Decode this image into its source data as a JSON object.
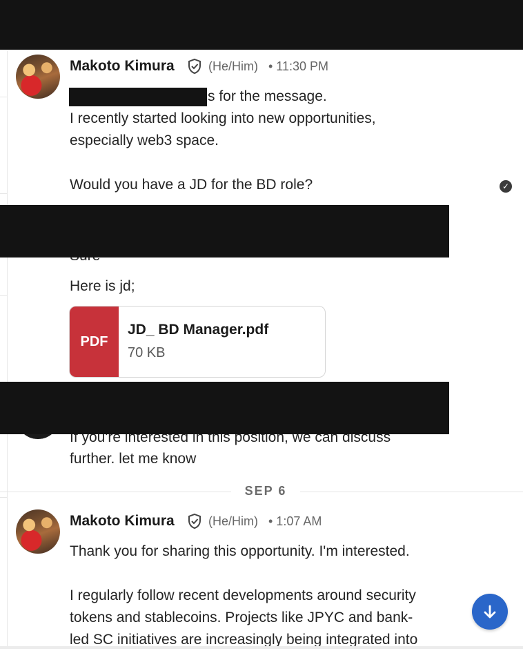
{
  "messages": [
    {
      "sender": "Makoto Kimura",
      "pronouns": "(He/Him)",
      "time": "• 11:30 PM",
      "lines": [
        "s for the message.",
        "I recently started looking into new opportunities,",
        "especially web3 space.",
        "",
        "Would you have a JD for the BD role?"
      ]
    },
    {
      "lines": [
        "Sure",
        "Here is jd;"
      ],
      "attachment": {
        "type_label": "PDF",
        "file_name": "JD_ BD Manager.pdf",
        "file_size": "70 KB"
      }
    },
    {
      "lines": [
        "If you're interested in this position, we can discuss",
        "further. let me know"
      ]
    },
    {
      "sender": "Makoto Kimura",
      "pronouns": "(He/Him)",
      "time": "• 1:07 AM",
      "lines": [
        "Thank you for sharing this opportunity. I'm interested.",
        "",
        "I regularly follow recent developments around security",
        "tokens and stablecoins. Projects like JPYC and bank-",
        "led SC initiatives are increasingly being integrated into"
      ]
    }
  ],
  "date_separator": "SEP 6",
  "icons": {
    "verified": "shield-check-icon",
    "read_receipt": "check-circle-icon",
    "scroll_down": "arrow-down-icon"
  },
  "colors": {
    "accent": "#2a66c9",
    "pdf": "#c7323a",
    "redaction": "#131313"
  }
}
